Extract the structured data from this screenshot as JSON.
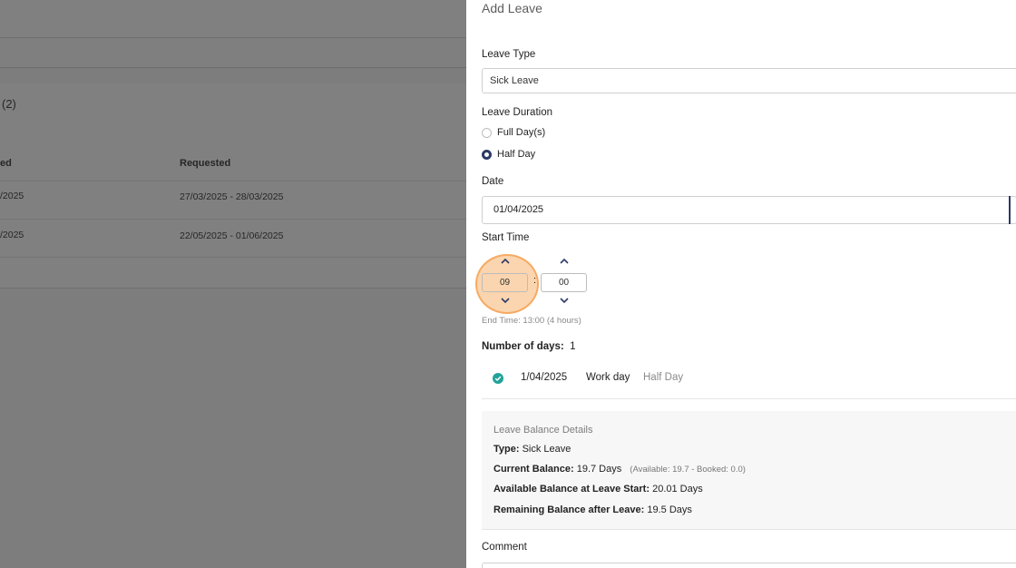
{
  "background": {
    "count_label": "(2)",
    "table": {
      "headers": [
        "ed",
        "Requested"
      ],
      "rows": [
        {
          "date_fragment": "/2025",
          "requested": "27/03/2025 - 28/03/2025"
        },
        {
          "date_fragment": "/2025",
          "requested": "22/05/2025 - 01/06/2025"
        }
      ]
    }
  },
  "panel": {
    "title": "Add Leave",
    "leave_type_label": "Leave Type",
    "leave_type_value": "Sick Leave",
    "duration_label": "Leave Duration",
    "duration_options": [
      {
        "label": "Full Day(s)",
        "checked": false
      },
      {
        "label": "Half Day",
        "checked": true
      }
    ],
    "date_label": "Date",
    "date_value": "01/04/2025",
    "start_time_label": "Start Time",
    "start_hour": "09",
    "start_minute": "00",
    "time_separator": ":",
    "end_time_text": "End Time: 13:00 (4 hours)",
    "days_label": "Number of days:",
    "days_value": "1",
    "day_entry": {
      "date": "1/04/2025",
      "type": "Work day",
      "portion": "Half Day"
    },
    "balance": {
      "title": "Leave Balance Details",
      "type_label": "Type:",
      "type_value": "Sick Leave",
      "current_label": "Current Balance:",
      "current_value": "19.7 Days",
      "current_detail": "(Available: 19.7 - Booked: 0.0)",
      "available_label": "Available Balance at Leave Start:",
      "available_value": "20.01 Days",
      "remaining_label": "Remaining Balance after Leave:",
      "remaining_value": "19.5 Days"
    },
    "comment_label": "Comment"
  },
  "colors": {
    "accent": "#2b3a67",
    "success": "#22a39a",
    "highlight": "#f8b26e"
  }
}
